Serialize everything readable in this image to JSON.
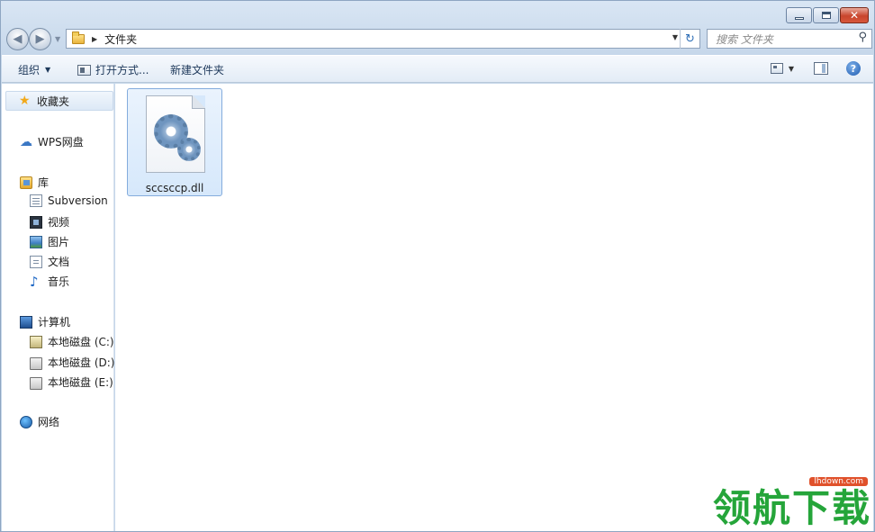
{
  "window": {
    "caption_buttons": {
      "minimize": "minimize",
      "maximize": "maximize",
      "close": "✕"
    }
  },
  "address_bar": {
    "path": [
      "文件夹"
    ],
    "refresh_glyph": "↻"
  },
  "search": {
    "placeholder": "搜索 文件夹"
  },
  "toolbar": {
    "organize_label": "组织",
    "open_with_label": "打开方式...",
    "new_folder_label": "新建文件夹"
  },
  "nav_pane": {
    "favorites": "收藏夹",
    "wps_cloud": "WPS网盘",
    "libraries": {
      "label": "库",
      "items": [
        "Subversion",
        "视频",
        "图片",
        "文档",
        "音乐"
      ]
    },
    "computer": {
      "label": "计算机",
      "drives": [
        "本地磁盘 (C:)",
        "本地磁盘 (D:)",
        "本地磁盘 (E:)"
      ]
    },
    "network": "网络"
  },
  "content": {
    "files": [
      {
        "name": "sccsccp.dll",
        "icon": "dll-gear-icon",
        "selected": true
      }
    ]
  },
  "watermark": {
    "url": "lhdown.com",
    "text": "领航下载"
  },
  "colors": {
    "selection": "#d6e8fb",
    "accent": "#2f6fb7",
    "watermark": "#25a53a"
  }
}
